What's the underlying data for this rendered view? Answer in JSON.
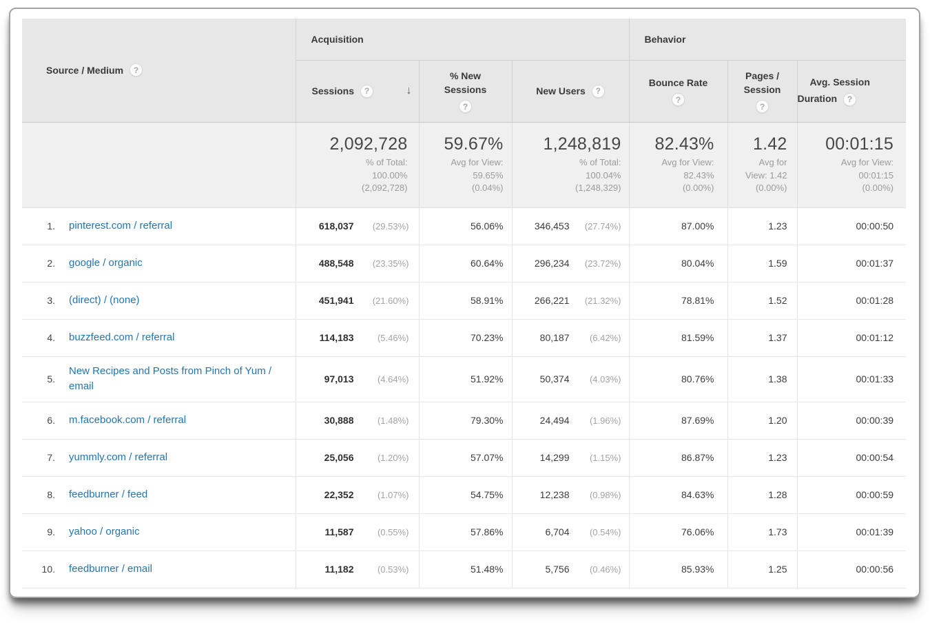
{
  "colors": {
    "link": "#2175b5",
    "header_bg": "#e7e7e7",
    "sorted_column_bg": "#f8f8f8"
  },
  "header": {
    "source_medium": "Source / Medium",
    "acquisition": "Acquisition",
    "behavior": "Behavior",
    "sessions": "Sessions",
    "pct_new_sessions": "% New Sessions",
    "new_users": "New Users",
    "bounce_rate": "Bounce Rate",
    "pages_session": "Pages / Session",
    "avg_session_duration": "Avg. Session Duration",
    "help": "?",
    "sort_desc": "↓"
  },
  "summary": {
    "sessions": {
      "value": "2,092,728",
      "sub": [
        "% of Total:",
        "100.00%",
        "(2,092,728)"
      ]
    },
    "pct_new_sessions": {
      "value": "59.67%",
      "sub": [
        "Avg for View:",
        "59.65%",
        "(0.04%)"
      ]
    },
    "new_users": {
      "value": "1,248,819",
      "sub": [
        "% of Total:",
        "100.04%",
        "(1,248,329)"
      ]
    },
    "bounce_rate": {
      "value": "82.43%",
      "sub": [
        "Avg for View:",
        "82.43%",
        "(0.00%)"
      ]
    },
    "pages_session": {
      "value": "1.42",
      "sub": [
        "Avg for",
        "View: 1.42",
        "(0.00%)"
      ]
    },
    "avg_session_duration": {
      "value": "00:01:15",
      "sub": [
        "Avg for View:",
        "00:01:15",
        "(0.00%)"
      ]
    }
  },
  "rows": [
    {
      "rank": "1.",
      "source": "pinterest.com / referral",
      "sessions": "618,037",
      "sessions_pct": "(29.53%)",
      "pct_new_sessions": "56.06%",
      "new_users": "346,453",
      "new_users_pct": "(27.74%)",
      "bounce_rate": "87.00%",
      "pages_session": "1.23",
      "avg_session_duration": "00:00:50"
    },
    {
      "rank": "2.",
      "source": "google / organic",
      "sessions": "488,548",
      "sessions_pct": "(23.35%)",
      "pct_new_sessions": "60.64%",
      "new_users": "296,234",
      "new_users_pct": "(23.72%)",
      "bounce_rate": "80.04%",
      "pages_session": "1.59",
      "avg_session_duration": "00:01:37"
    },
    {
      "rank": "3.",
      "source": "(direct) / (none)",
      "sessions": "451,941",
      "sessions_pct": "(21.60%)",
      "pct_new_sessions": "58.91%",
      "new_users": "266,221",
      "new_users_pct": "(21.32%)",
      "bounce_rate": "78.81%",
      "pages_session": "1.52",
      "avg_session_duration": "00:01:28"
    },
    {
      "rank": "4.",
      "source": "buzzfeed.com / referral",
      "sessions": "114,183",
      "sessions_pct": "(5.46%)",
      "pct_new_sessions": "70.23%",
      "new_users": "80,187",
      "new_users_pct": "(6.42%)",
      "bounce_rate": "81.59%",
      "pages_session": "1.37",
      "avg_session_duration": "00:01:12"
    },
    {
      "rank": "5.",
      "source": "New Recipes and Posts from Pinch of Yum / email",
      "sessions": "97,013",
      "sessions_pct": "(4.64%)",
      "pct_new_sessions": "51.92%",
      "new_users": "50,374",
      "new_users_pct": "(4.03%)",
      "bounce_rate": "80.76%",
      "pages_session": "1.38",
      "avg_session_duration": "00:01:33"
    },
    {
      "rank": "6.",
      "source": "m.facebook.com / referral",
      "sessions": "30,888",
      "sessions_pct": "(1.48%)",
      "pct_new_sessions": "79.30%",
      "new_users": "24,494",
      "new_users_pct": "(1.96%)",
      "bounce_rate": "87.69%",
      "pages_session": "1.20",
      "avg_session_duration": "00:00:39"
    },
    {
      "rank": "7.",
      "source": "yummly.com / referral",
      "sessions": "25,056",
      "sessions_pct": "(1.20%)",
      "pct_new_sessions": "57.07%",
      "new_users": "14,299",
      "new_users_pct": "(1.15%)",
      "bounce_rate": "86.87%",
      "pages_session": "1.23",
      "avg_session_duration": "00:00:54"
    },
    {
      "rank": "8.",
      "source": "feedburner / feed",
      "sessions": "22,352",
      "sessions_pct": "(1.07%)",
      "pct_new_sessions": "54.75%",
      "new_users": "12,238",
      "new_users_pct": "(0.98%)",
      "bounce_rate": "84.63%",
      "pages_session": "1.28",
      "avg_session_duration": "00:00:59"
    },
    {
      "rank": "9.",
      "source": "yahoo / organic",
      "sessions": "11,587",
      "sessions_pct": "(0.55%)",
      "pct_new_sessions": "57.86%",
      "new_users": "6,704",
      "new_users_pct": "(0.54%)",
      "bounce_rate": "76.06%",
      "pages_session": "1.73",
      "avg_session_duration": "00:01:39"
    },
    {
      "rank": "10.",
      "source": "feedburner / email",
      "sessions": "11,182",
      "sessions_pct": "(0.53%)",
      "pct_new_sessions": "51.48%",
      "new_users": "5,756",
      "new_users_pct": "(0.46%)",
      "bounce_rate": "85.93%",
      "pages_session": "1.25",
      "avg_session_duration": "00:00:56"
    }
  ]
}
